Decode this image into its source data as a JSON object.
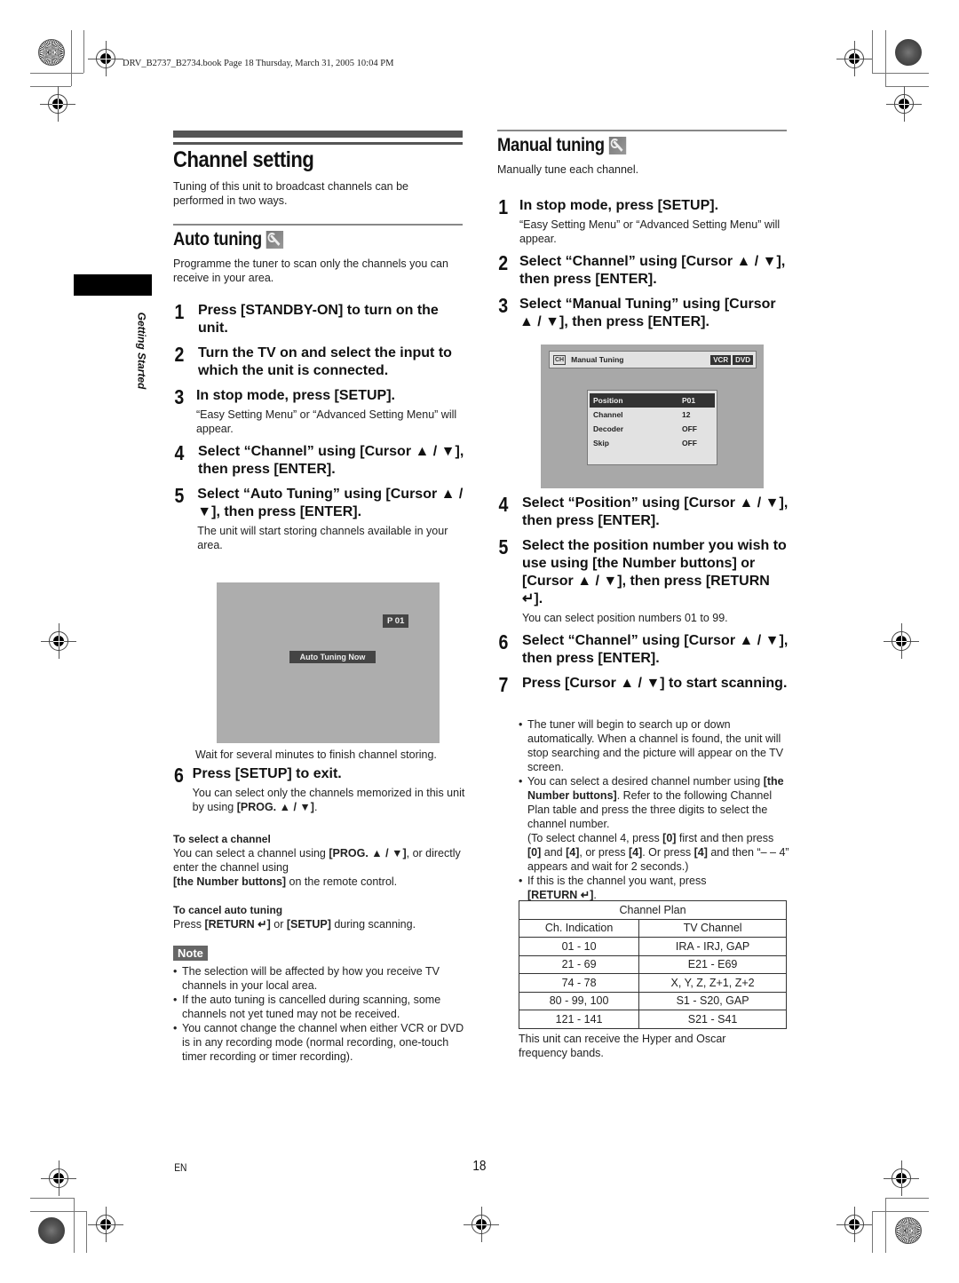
{
  "print_header": "DRV_B2737_B2734.book  Page 18  Thursday, March 31, 2005  10:04 PM",
  "side_tab": {
    "label": "Getting Started"
  },
  "left": {
    "title": "Channel setting",
    "intro": "Tuning of this unit to broadcast channels can be performed in two ways.",
    "auto_tuning": {
      "heading": "Auto tuning",
      "icon": "wrench-icon",
      "intro": "Programme the tuner to scan only the channels you can receive in your area.",
      "steps": [
        {
          "num": "1",
          "text": "Press [STANDBY-ON] to turn on the unit.",
          "sub": ""
        },
        {
          "num": "2",
          "text": "Turn the TV on and select the input to which the unit is connected.",
          "sub": ""
        },
        {
          "num": "3",
          "text": "In stop mode, press [SETUP].",
          "sub": "“Easy Setting Menu” or “Advanced Setting Menu” will appear."
        },
        {
          "num": "4",
          "text": "Select “Channel” using [Cursor ▲ / ▼], then press [ENTER].",
          "sub": ""
        },
        {
          "num": "5",
          "text": "Select “Auto Tuning” using [Cursor ▲ / ▼], then press [ENTER].",
          "sub": "The unit will start storing channels available in your area."
        }
      ],
      "screen": {
        "position": "P 01",
        "status": "Auto Tuning Now"
      },
      "screen_caption": "Wait for several minutes to finish channel storing.",
      "step6": {
        "num": "6",
        "text": "Press [SETUP] to exit.",
        "sub_prefix": "You can select only the channels memorized in this unit by using ",
        "sub_bold": "[PROG. ▲ / ▼]",
        "sub_suffix": "."
      },
      "select_channel": {
        "heading": "To select a channel",
        "line1_prefix": "You can select a channel using ",
        "line1_bold": "[PROG. ▲ / ▼]",
        "line1_suffix": ", or directly enter the channel using",
        "line2_bold": "[the Number buttons]",
        "line2_suffix": " on the remote control."
      },
      "cancel": {
        "heading": "To cancel auto tuning",
        "prefix": "Press ",
        "bold1": "[RETURN ↵]",
        "mid": " or ",
        "bold2": "[SETUP]",
        "suffix": " during scanning."
      },
      "note": {
        "label": "Note",
        "items": [
          "The selection will be affected by how you receive TV channels in your local area.",
          "If the auto tuning is cancelled during scanning, some channels not yet tuned may not be received.",
          "You cannot change the channel when either VCR or DVD is in any recording mode (normal recording, one-touch timer recording or timer recording)."
        ]
      }
    }
  },
  "right": {
    "manual_tuning": {
      "heading": "Manual tuning",
      "icon": "wrench-icon",
      "intro": "Manually tune each channel.",
      "steps_a": [
        {
          "num": "1",
          "text": "In stop mode, press [SETUP].",
          "sub": "“Easy Setting Menu” or “Advanced Setting Menu” will appear."
        },
        {
          "num": "2",
          "text": "Select “Channel” using [Cursor ▲ / ▼], then press [ENTER].",
          "sub": ""
        },
        {
          "num": "3",
          "text": "Select “Manual Tuning” using [Cursor ▲ / ▼], then press [ENTER].",
          "sub": ""
        }
      ],
      "screen": {
        "ch_badge": "CH",
        "title": "Manual Tuning",
        "tags": [
          "VCR",
          "DVD"
        ],
        "rows": [
          {
            "key": "Position",
            "value": "P01",
            "selected": true
          },
          {
            "key": "Channel",
            "value": "12",
            "selected": false
          },
          {
            "key": "Decoder",
            "value": "OFF",
            "selected": false
          },
          {
            "key": "Skip",
            "value": "OFF",
            "selected": false
          }
        ]
      },
      "steps_b": [
        {
          "num": "4",
          "text": "Select “Position” using [Cursor ▲ / ▼], then press [ENTER].",
          "sub": ""
        },
        {
          "num": "5",
          "text": "Select the position number you wish to use using [the Number buttons] or [Cursor ▲ / ▼], then press [RETURN ↵].",
          "sub": "You can select position numbers 01 to 99."
        },
        {
          "num": "6",
          "text": "Select “Channel” using [Cursor ▲ / ▼], then press [ENTER].",
          "sub": ""
        },
        {
          "num": "7",
          "text": "Press [Cursor ▲ / ▼] to start scanning.",
          "sub": ""
        }
      ],
      "bullets": [
        {
          "html_parts": [
            [
              "",
              "The tuner will begin to search up or down automatically. When a channel is found, the unit will stop searching and the picture will appear on the TV screen."
            ]
          ]
        },
        {
          "html_parts": [
            [
              "",
              "You can select a desired channel number using "
            ],
            [
              "b",
              "[the Number buttons]"
            ],
            [
              "",
              ". Refer to the following Channel Plan table and press the three digits to select the channel number."
            ],
            [
              "br",
              ""
            ],
            [
              "",
              "(To select channel 4, press "
            ],
            [
              "b",
              "[0]"
            ],
            [
              "",
              " first and then press "
            ],
            [
              "b",
              "[0]"
            ],
            [
              "",
              " and "
            ],
            [
              "b",
              "[4]"
            ],
            [
              "",
              ", or press "
            ],
            [
              "b",
              "[4]"
            ],
            [
              "",
              ". Or press "
            ],
            [
              "b",
              "[4]"
            ],
            [
              "",
              " and then “– – 4” appears and wait for 2 seconds.)"
            ]
          ]
        },
        {
          "html_parts": [
            [
              "",
              "If this is the channel you want, press "
            ],
            [
              "br",
              ""
            ],
            [
              "b",
              "[RETURN ↵]"
            ],
            [
              "",
              "."
            ]
          ]
        }
      ],
      "table": {
        "title": "Channel Plan",
        "headers": [
          "Ch. Indication",
          "TV Channel"
        ],
        "rows": [
          [
            "01 - 10",
            "IRA - IRJ, GAP"
          ],
          [
            "21 - 69",
            "E21 - E69"
          ],
          [
            "74 - 78",
            "X, Y, Z, Z+1, Z+2"
          ],
          [
            "80 - 99, 100",
            "S1 - S20, GAP"
          ],
          [
            "121 - 141",
            "S21 - S41"
          ]
        ]
      },
      "table_note": "This unit can receive the Hyper and Oscar frequency bands."
    }
  },
  "footer": {
    "lang": "EN",
    "page": "18"
  }
}
